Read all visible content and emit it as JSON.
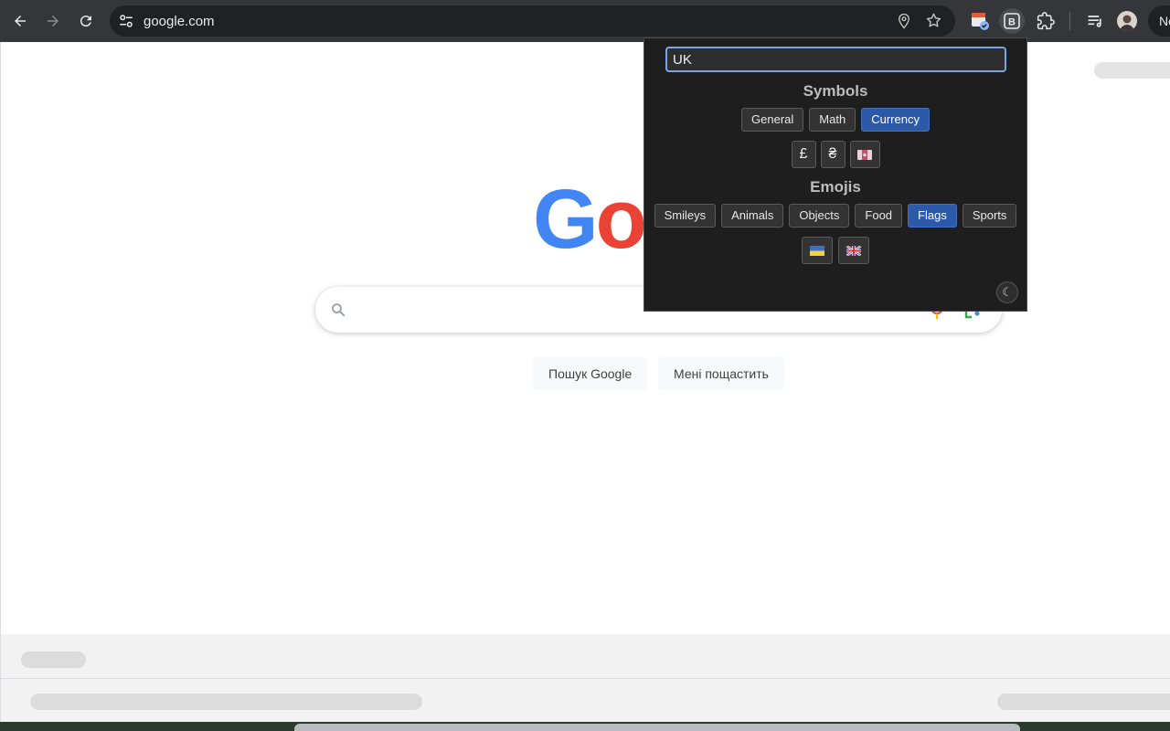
{
  "browser": {
    "url": "google.com",
    "profile_initial": "Ne"
  },
  "google": {
    "logo_letters": [
      "G",
      "o",
      "o"
    ],
    "logo_colors": [
      "#4285f4",
      "#ea4335",
      "#fbbc05"
    ],
    "search_button": "Пошук Google",
    "lucky_button": "Мені пощастить"
  },
  "popup": {
    "search_value": "UK",
    "symbols_title": "Symbols",
    "symbol_categories": [
      {
        "label": "General",
        "selected": false
      },
      {
        "label": "Math",
        "selected": false
      },
      {
        "label": "Currency",
        "selected": true
      }
    ],
    "symbols": [
      "£",
      "₴",
      "💷"
    ],
    "emojis_title": "Emojis",
    "emoji_categories": [
      {
        "label": "Smileys",
        "selected": false
      },
      {
        "label": "Animals",
        "selected": false
      },
      {
        "label": "Objects",
        "selected": false
      },
      {
        "label": "Food",
        "selected": false
      },
      {
        "label": "Flags",
        "selected": true
      },
      {
        "label": "Sports",
        "selected": false
      }
    ],
    "emojis": [
      "flag-ukraine",
      "flag-united-kingdom"
    ],
    "theme_toggle_icon": "moon-icon"
  },
  "colors": {
    "accent": "#2d5aa8",
    "popup_bg": "#1e1e1e",
    "toolbar_bg": "#35363a"
  }
}
